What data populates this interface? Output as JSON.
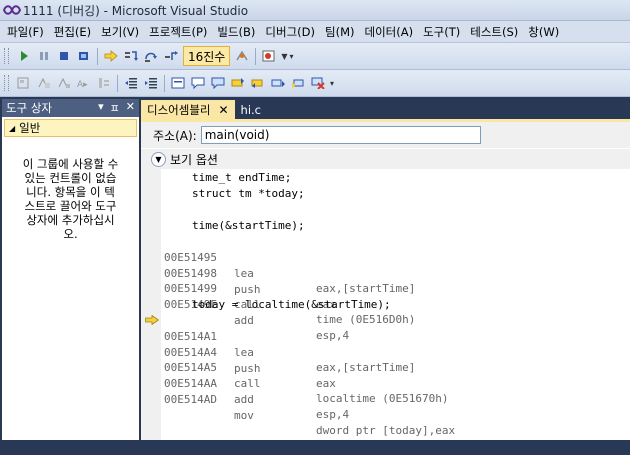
{
  "window": {
    "title": "1111 (디버깅) - Microsoft Visual Studio"
  },
  "menu": [
    "파일(F)",
    "편집(E)",
    "보기(V)",
    "프로젝트(P)",
    "빌드(B)",
    "디버그(D)",
    "팀(M)",
    "데이터(A)",
    "도구(T)",
    "테스트(S)",
    "창(W)"
  ],
  "toolbar": {
    "hex_label": "16진수"
  },
  "colors": {
    "title_bg": "#293955",
    "active_tab": "#fbe7a5",
    "current_line_arrow": "#f5d03a"
  },
  "toolbox": {
    "title": "도구 상자",
    "group": "일반",
    "empty_message": [
      "이 그룹에 사용할 수",
      "있는 컨트롤이 없습",
      "니다. 항목을 이 텍",
      "스트로 끌어와 도구",
      "상자에 추가하십시",
      "오."
    ]
  },
  "tabs": [
    {
      "label": "디스어셈블리",
      "active": true
    },
    {
      "label": "hi.c",
      "active": false
    }
  ],
  "address": {
    "label": "주소(A):",
    "value": "main(void)"
  },
  "view_options": {
    "label": "보기 옵션"
  },
  "code": {
    "source_lines": [
      "time_t endTime;",
      "struct tm *today;",
      "",
      "time(&startTime);"
    ],
    "block1": [
      {
        "addr": "00E51495",
        "op": "lea",
        "args": "eax,[startTime]"
      },
      {
        "addr": "00E51498",
        "op": "push",
        "args": "eax"
      },
      {
        "addr": "00E51499",
        "op": "call",
        "args": "time (0E516D0h)"
      },
      {
        "addr": "00E5149E",
        "op": "add",
        "args": "esp,4"
      }
    ],
    "source_line2": "today = localtime(&startTime);",
    "block2": [
      {
        "addr": "00E514A1",
        "op": "lea",
        "args": "eax,[startTime]",
        "current": true
      },
      {
        "addr": "00E514A4",
        "op": "push",
        "args": "eax"
      },
      {
        "addr": "00E514A5",
        "op": "call",
        "args": "localtime (0E51670h)"
      },
      {
        "addr": "00E514AA",
        "op": "add",
        "args": "esp,4"
      },
      {
        "addr": "00E514AD",
        "op": "mov",
        "args": "dword ptr [today],eax"
      }
    ]
  }
}
